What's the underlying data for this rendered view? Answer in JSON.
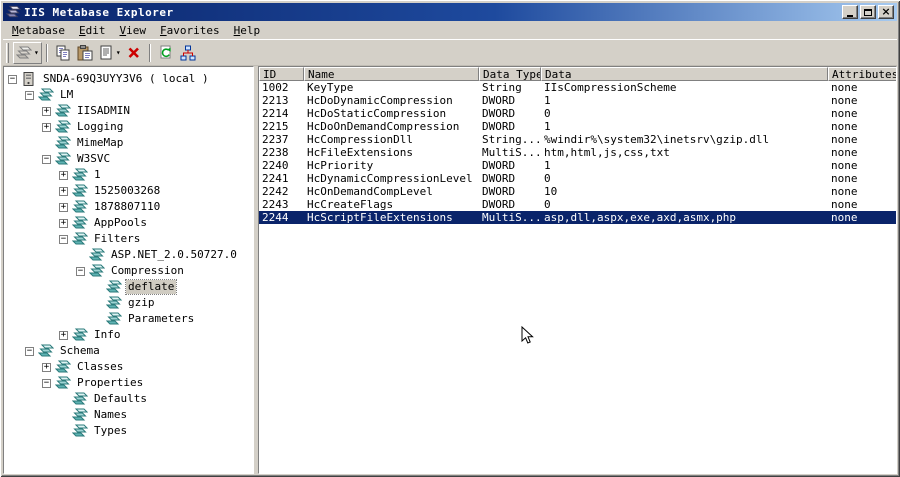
{
  "window": {
    "title": "IIS Metabase Explorer",
    "accent_color": "#0a246a",
    "face_color": "#d4d0c8",
    "selection_color": "#0a246a"
  },
  "menu": {
    "items": [
      {
        "label": "Metabase"
      },
      {
        "label": "Edit"
      },
      {
        "label": "View"
      },
      {
        "label": "Favorites"
      },
      {
        "label": "Help"
      }
    ]
  },
  "toolbar": {
    "buttons": [
      {
        "type": "button",
        "name": "new-key-button",
        "icon": "new-key-icon",
        "dropdown": true
      },
      {
        "type": "separator"
      },
      {
        "type": "button",
        "name": "copy-button",
        "icon": "copy-icon"
      },
      {
        "type": "button",
        "name": "paste-button",
        "icon": "paste-icon"
      },
      {
        "type": "button",
        "name": "edit-record-button",
        "icon": "edit-icon",
        "dropdown": true
      },
      {
        "type": "button",
        "name": "delete-button",
        "icon": "delete-icon"
      },
      {
        "type": "separator"
      },
      {
        "type": "button",
        "name": "refresh-button",
        "icon": "refresh-icon"
      },
      {
        "type": "button",
        "name": "connections-button",
        "icon": "network-icon"
      }
    ]
  },
  "tree": {
    "nodes": [
      {
        "label": "SNDA-69Q3UYY3V6 ( local )",
        "level": 0,
        "expander": "minus",
        "icon": "server-icon",
        "selected": false
      },
      {
        "label": "LM",
        "level": 1,
        "expander": "minus",
        "icon": "key-icon",
        "selected": false
      },
      {
        "label": "IISADMIN",
        "level": 2,
        "expander": "plus",
        "icon": "key-icon",
        "selected": false
      },
      {
        "label": "Logging",
        "level": 2,
        "expander": "plus",
        "icon": "key-icon",
        "selected": false
      },
      {
        "label": "MimeMap",
        "level": 2,
        "expander": "none",
        "icon": "key-icon",
        "selected": false
      },
      {
        "label": "W3SVC",
        "level": 2,
        "expander": "minus",
        "icon": "key-icon",
        "selected": false
      },
      {
        "label": "1",
        "level": 3,
        "expander": "plus",
        "icon": "key-icon",
        "selected": false
      },
      {
        "label": "1525003268",
        "level": 3,
        "expander": "plus",
        "icon": "key-icon",
        "selected": false
      },
      {
        "label": "1878807110",
        "level": 3,
        "expander": "plus",
        "icon": "key-icon",
        "selected": false
      },
      {
        "label": "AppPools",
        "level": 3,
        "expander": "plus",
        "icon": "key-icon",
        "selected": false
      },
      {
        "label": "Filters",
        "level": 3,
        "expander": "minus",
        "icon": "key-icon",
        "selected": false
      },
      {
        "label": "ASP.NET_2.0.50727.0",
        "level": 4,
        "expander": "none",
        "icon": "key-icon",
        "selected": false
      },
      {
        "label": "Compression",
        "level": 4,
        "expander": "minus",
        "icon": "key-icon",
        "selected": false
      },
      {
        "label": "deflate",
        "level": 5,
        "expander": "none",
        "icon": "key-icon",
        "selected": true
      },
      {
        "label": "gzip",
        "level": 5,
        "expander": "none",
        "icon": "key-icon",
        "selected": false
      },
      {
        "label": "Parameters",
        "level": 5,
        "expander": "none",
        "icon": "key-icon",
        "selected": false
      },
      {
        "label": "Info",
        "level": 3,
        "expander": "plus",
        "icon": "key-icon",
        "selected": false
      },
      {
        "label": "Schema",
        "level": 1,
        "expander": "minus",
        "icon": "key-icon",
        "selected": false
      },
      {
        "label": "Classes",
        "level": 2,
        "expander": "plus",
        "icon": "key-icon",
        "selected": false
      },
      {
        "label": "Properties",
        "level": 2,
        "expander": "minus",
        "icon": "key-icon",
        "selected": false
      },
      {
        "label": "Defaults",
        "level": 3,
        "expander": "none",
        "icon": "key-icon",
        "selected": false
      },
      {
        "label": "Names",
        "level": 3,
        "expander": "none",
        "icon": "key-icon",
        "selected": false
      },
      {
        "label": "Types",
        "level": 3,
        "expander": "none",
        "icon": "key-icon",
        "selected": false
      }
    ]
  },
  "table": {
    "columns": [
      "ID",
      "Name",
      "Data Type",
      "Data",
      "Attributes"
    ],
    "rows": [
      {
        "cells": [
          "1002",
          "KeyType",
          "String",
          "IIsCompressionScheme",
          "none"
        ],
        "selected": false
      },
      {
        "cells": [
          "2213",
          "HcDoDynamicCompression",
          "DWORD",
          "1",
          "none"
        ],
        "selected": false
      },
      {
        "cells": [
          "2214",
          "HcDoStaticCompression",
          "DWORD",
          "0",
          "none"
        ],
        "selected": false
      },
      {
        "cells": [
          "2215",
          "HcDoOnDemandCompression",
          "DWORD",
          "1",
          "none"
        ],
        "selected": false
      },
      {
        "cells": [
          "2237",
          "HcCompressionDll",
          "String...",
          "%windir%\\system32\\inetsrv\\gzip.dll",
          "none"
        ],
        "selected": false
      },
      {
        "cells": [
          "2238",
          "HcFileExtensions",
          "MultiS...",
          "htm,html,js,css,txt",
          "none"
        ],
        "selected": false
      },
      {
        "cells": [
          "2240",
          "HcPriority",
          "DWORD",
          "1",
          "none"
        ],
        "selected": false
      },
      {
        "cells": [
          "2241",
          "HcDynamicCompressionLevel",
          "DWORD",
          "0",
          "none"
        ],
        "selected": false
      },
      {
        "cells": [
          "2242",
          "HcOnDemandCompLevel",
          "DWORD",
          "10",
          "none"
        ],
        "selected": false
      },
      {
        "cells": [
          "2243",
          "HcCreateFlags",
          "DWORD",
          "0",
          "none"
        ],
        "selected": false
      },
      {
        "cells": [
          "2244",
          "HcScriptFileExtensions",
          "MultiS...",
          "asp,dll,aspx,exe,axd,asmx,php",
          "none"
        ],
        "selected": true
      }
    ]
  }
}
